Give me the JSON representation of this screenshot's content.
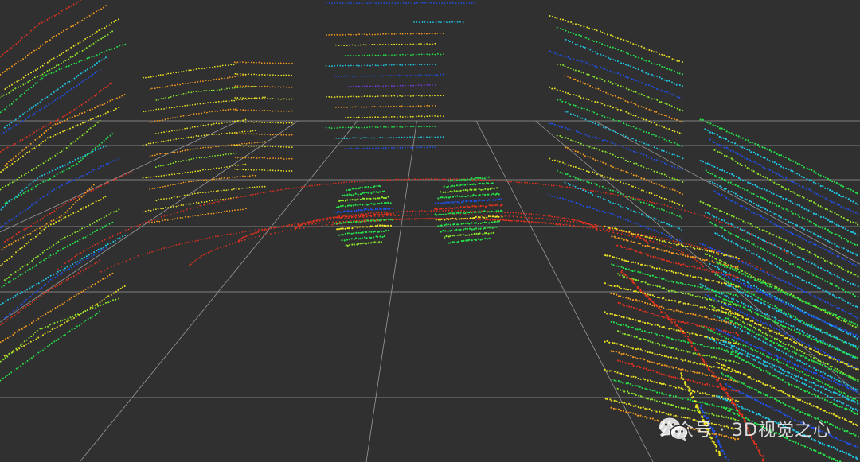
{
  "viewer": {
    "background_color": "#303030",
    "grid_color": "#9a9a9a"
  },
  "watermark": {
    "logo_icon": "wechat-icon",
    "text": "公众号 · 3D视觉之心"
  },
  "colors": {
    "red": "#e0321e",
    "orange": "#f29a1e",
    "yellow": "#e8e023",
    "lime": "#8ce62a",
    "green": "#26e04a",
    "cyan": "#1ec8e6",
    "blue": "#2050e6",
    "purple": "#7a3ce6"
  }
}
